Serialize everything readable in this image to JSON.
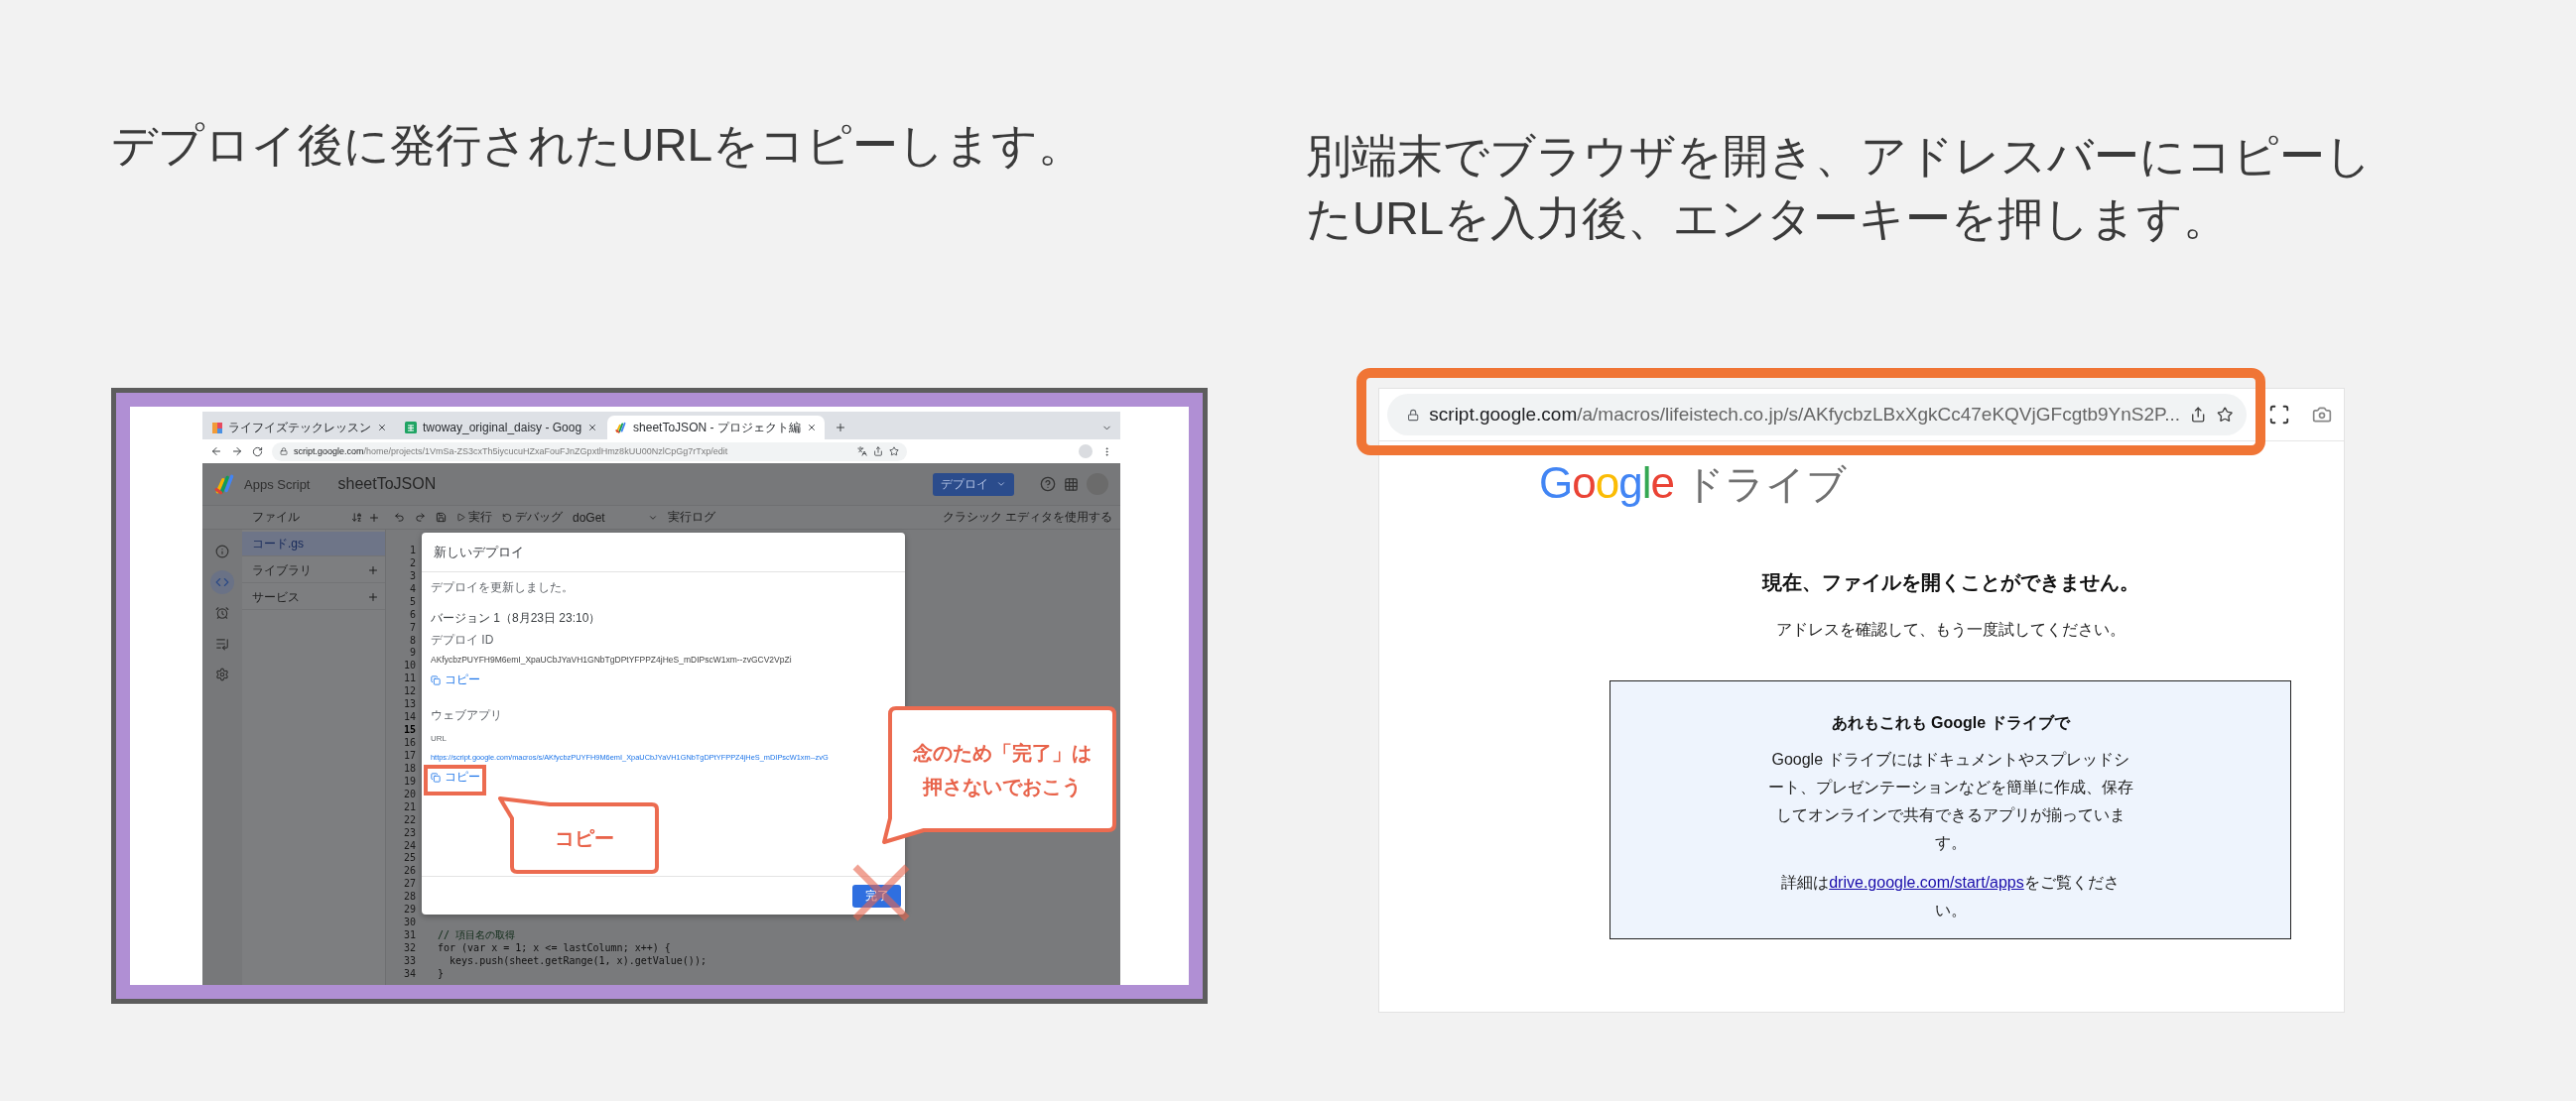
{
  "steps": [
    {
      "caption": "デプロイ後に発行されたURLをコピーします。"
    },
    {
      "caption": "別端末でブラウザを開き、アドレスバーにコピーしたURLを入力後、エンターキーを押します。"
    }
  ],
  "left_screenshot": {
    "tabs": [
      {
        "title": "ライフイズテックレッスン",
        "kind": "lesson",
        "selected": false
      },
      {
        "title": "twoway_original_daisy - Goog",
        "kind": "sheets",
        "selected": false
      },
      {
        "title": "sheetToJSON - プロジェクト編",
        "kind": "script",
        "selected": true
      }
    ],
    "url_host": "script.google.com",
    "url_path": "/home/projects/1VmSa-ZS3cxTh5iycucuHZxaFouFJnZGpxtlHmz8kUU00NzlCpGg7rTxp/edit",
    "app_name": "Apps Script",
    "project": "sheetToJSON",
    "deploy_button": "デプロイ",
    "files_header": "ファイル",
    "run": "実行",
    "debug": "デバッグ",
    "function": "doGet",
    "log": "実行ログ",
    "classic": "クラシック エディタを使用する",
    "rail": [
      {
        "kind": "info",
        "selected": false
      },
      {
        "kind": "code",
        "selected": true
      },
      {
        "kind": "trigger",
        "selected": false
      },
      {
        "kind": "executions",
        "selected": false
      },
      {
        "kind": "settings",
        "selected": false
      }
    ],
    "files": [
      {
        "name": "コード.gs",
        "selected": true,
        "addable": false
      },
      {
        "name": "ライブラリ",
        "selected": false,
        "addable": true
      },
      {
        "name": "サービス",
        "selected": false,
        "addable": true
      }
    ],
    "lines": [
      {
        "number": "1",
        "current": false
      },
      {
        "number": "2",
        "current": false
      },
      {
        "number": "3",
        "current": false
      },
      {
        "number": "4",
        "current": false
      },
      {
        "number": "5",
        "current": false
      },
      {
        "number": "6",
        "current": false
      },
      {
        "number": "7",
        "current": false
      },
      {
        "number": "8",
        "current": false
      },
      {
        "number": "9",
        "current": false
      },
      {
        "number": "10",
        "current": false
      },
      {
        "number": "11",
        "current": false
      },
      {
        "number": "12",
        "current": false
      },
      {
        "number": "13",
        "current": false
      },
      {
        "number": "14",
        "current": false
      },
      {
        "number": "15",
        "current": true
      },
      {
        "number": "16",
        "current": false
      },
      {
        "number": "17",
        "current": false
      },
      {
        "number": "18",
        "current": false
      },
      {
        "number": "19",
        "current": false
      },
      {
        "number": "20",
        "current": false
      },
      {
        "number": "21",
        "current": false
      },
      {
        "number": "22",
        "current": false
      },
      {
        "number": "23",
        "current": false
      },
      {
        "number": "24",
        "current": false
      },
      {
        "number": "25",
        "current": false
      },
      {
        "number": "26",
        "current": false
      },
      {
        "number": "27",
        "current": false
      },
      {
        "number": "28",
        "current": false
      },
      {
        "number": "29",
        "current": false
      },
      {
        "number": "30",
        "current": false
      },
      {
        "number": "31",
        "current": false,
        "code": "// 項目名の取得",
        "kind": "comment"
      },
      {
        "number": "32",
        "current": false,
        "code": "for (var x = 1; x <= lastColumn; x++) {",
        "kind": "code"
      },
      {
        "number": "33",
        "current": false,
        "code": "  keys.push(sheet.getRange(1, x).getValue());",
        "kind": "code"
      },
      {
        "number": "34",
        "current": false,
        "code": "}",
        "kind": "code"
      }
    ],
    "dialog": {
      "title": "新しいデプロイ",
      "message": "デプロイを更新しました。",
      "version": "バージョン 1（8月23日 23:10）",
      "id_label": "デプロイ ID",
      "id": "AKfycbzPUYFH9M6emI_XpaUCbJYaVH1GNbTgDPtYFPPZ4jHeS_mDIPscW1xm--zvGCV2VpZi",
      "id_copy": "コピー",
      "section": "ウェブアプリ",
      "url_label": "URL",
      "url": "https://script.google.com/macros/s/AKfycbzPUYFH9M6emI_XpaUCbJYaVH1GNbTgDPtYFPPZ4jHeS_mDIPscW1xm--zvG",
      "url_copy": "コピー",
      "done": "完了"
    },
    "callouts": [
      {
        "text": "コピー"
      },
      {
        "text": "念のため「完了」は押さないでおこう"
      }
    ]
  },
  "right_screenshot": {
    "url_host": "script.google.com",
    "url_path": "/a/macros/lifeistech.co.jp/s/AKfycbzLBxXgkCc47eKQVjGFcgtb9YnS2P...",
    "logo": "Google",
    "product": "ドライブ",
    "heading": "現在、ファイルを開くことができません。",
    "subtext": "アドレスを確認して、もう一度試してください。",
    "promo": {
      "title": "あれもこれも Google ドライブで",
      "body": "Google ドライブにはドキュメントやスプレッドシート、プレゼンテーションなどを簡単に作成、保存してオンラインで共有できるアプリが揃っています。",
      "more_prefix": "詳細は",
      "link": "drive.google.com/start/apps",
      "more_suffix": "をご覧ください。"
    }
  }
}
